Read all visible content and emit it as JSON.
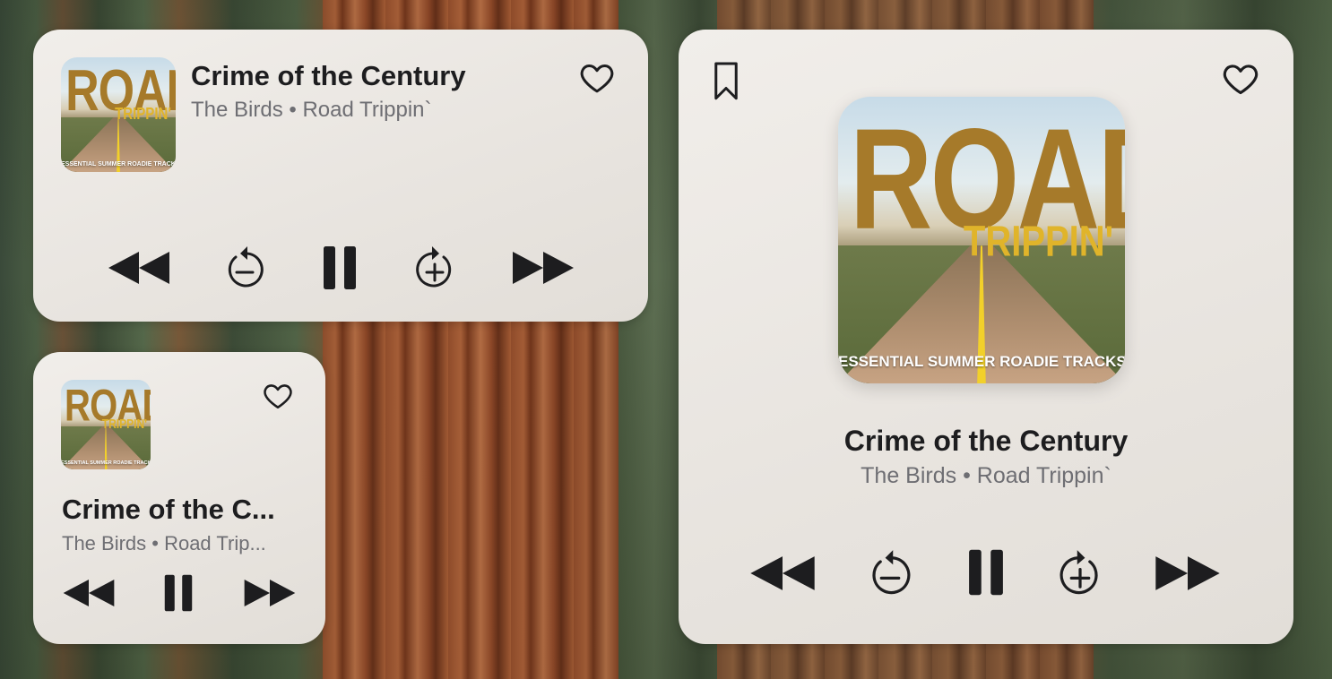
{
  "track": {
    "title": "Crime of the Century",
    "title_truncated": "Crime of the C...",
    "subtitle": "The Birds • Road Trippin`",
    "subtitle_truncated": "The Birds • Road Trip..."
  },
  "album_art": {
    "word_top": "ROAD",
    "word_bottom": "TRIPPIN'",
    "tagline": "ESSENTIAL SUMMER ROADIE TRACKS"
  },
  "icons": {
    "favorite": "heart-icon",
    "bookmark": "bookmark-icon",
    "previous": "rewind-icon",
    "skip_back": "skip-back-icon",
    "pause": "pause-icon",
    "skip_forward": "skip-forward-icon",
    "next": "fast-forward-icon"
  },
  "colors": {
    "widget_bg": "#ece8e3",
    "title": "#1d1d1f",
    "subtitle": "#6e6e73",
    "album_gold": "#a67a2a",
    "album_yellow": "#e0b42a"
  }
}
